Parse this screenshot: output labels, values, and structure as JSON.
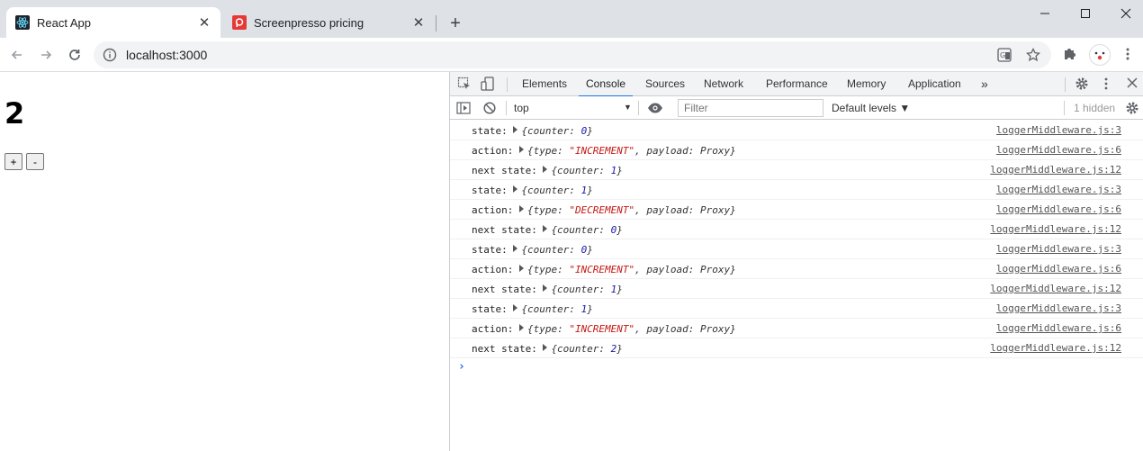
{
  "tabs": [
    {
      "title": "React App",
      "favicon": "react-icon",
      "active": true
    },
    {
      "title": "Screenpresso pricing",
      "favicon": "screenpresso-icon",
      "active": false
    }
  ],
  "address_bar": {
    "url": "localhost:3000"
  },
  "page": {
    "counter": "2",
    "increment_label": "+",
    "decrement_label": "-"
  },
  "devtools": {
    "tabs": [
      "Elements",
      "Console",
      "Sources",
      "Network",
      "Performance",
      "Memory",
      "Application"
    ],
    "active_tab": "Console",
    "more_tabs": "»",
    "context": "top",
    "filter_placeholder": "Filter",
    "levels": "Default levels ▼",
    "hidden_count": "1 hidden",
    "colors": {
      "accent": "#1a73e8",
      "string": "#c41a16",
      "number": "#1a1aa6"
    }
  },
  "console_logs": [
    {
      "label": "state:",
      "open": "{counter: ",
      "val": "0",
      "close": "}",
      "src": "loggerMiddleware.js:3"
    },
    {
      "label": "action:",
      "type": "INCREMENT",
      "src": "loggerMiddleware.js:6"
    },
    {
      "label": "next state:",
      "open": "{counter: ",
      "val": "1",
      "close": "}",
      "src": "loggerMiddleware.js:12"
    },
    {
      "label": "state:",
      "open": "{counter: ",
      "val": "1",
      "close": "}",
      "src": "loggerMiddleware.js:3"
    },
    {
      "label": "action:",
      "type": "DECREMENT",
      "src": "loggerMiddleware.js:6"
    },
    {
      "label": "next state:",
      "open": "{counter: ",
      "val": "0",
      "close": "}",
      "src": "loggerMiddleware.js:12"
    },
    {
      "label": "state:",
      "open": "{counter: ",
      "val": "0",
      "close": "}",
      "src": "loggerMiddleware.js:3"
    },
    {
      "label": "action:",
      "type": "INCREMENT",
      "src": "loggerMiddleware.js:6"
    },
    {
      "label": "next state:",
      "open": "{counter: ",
      "val": "1",
      "close": "}",
      "src": "loggerMiddleware.js:12"
    },
    {
      "label": "state:",
      "open": "{counter: ",
      "val": "1",
      "close": "}",
      "src": "loggerMiddleware.js:3"
    },
    {
      "label": "action:",
      "type": "INCREMENT",
      "src": "loggerMiddleware.js:6"
    },
    {
      "label": "next state:",
      "open": "{counter: ",
      "val": "2",
      "close": "}",
      "src": "loggerMiddleware.js:12"
    }
  ],
  "action_obj": {
    "prefix": "{type: ",
    "suffix": ", payload: Proxy}"
  }
}
